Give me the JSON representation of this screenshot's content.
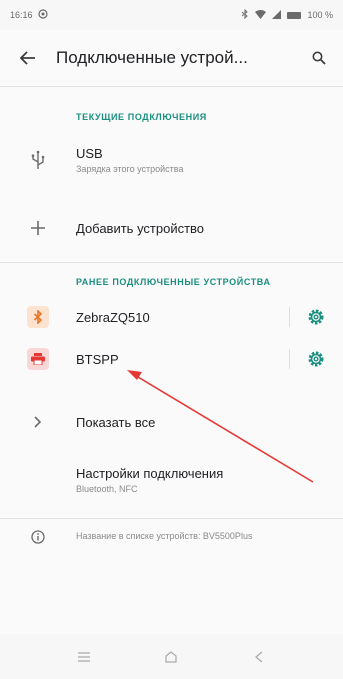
{
  "status_bar": {
    "time": "16:16",
    "battery_percent": "100 %"
  },
  "app_bar": {
    "title": "Подключенные устрой..."
  },
  "sections": {
    "current_header": "Текущие подключения",
    "previous_header": "Ранее подключенные устройства"
  },
  "current": {
    "usb_title": "USB",
    "usb_subtitle": "Зарядка этого устройства",
    "add_device": "Добавить устройство"
  },
  "previous_devices": [
    {
      "name": "ZebraZQ510",
      "icon": "bluetooth-icon",
      "color": "#e5762b"
    },
    {
      "name": "BTSPP",
      "icon": "printer-icon",
      "color": "#e53935"
    }
  ],
  "show_all": "Показать все",
  "connection_settings": {
    "title": "Настройки подключения",
    "subtitle": "Bluetooth, NFC"
  },
  "device_name_info": "Название в списке устройств: BV5500Plus",
  "colors": {
    "accent": "#1a8f7f",
    "annotation_arrow": "#e53935"
  }
}
